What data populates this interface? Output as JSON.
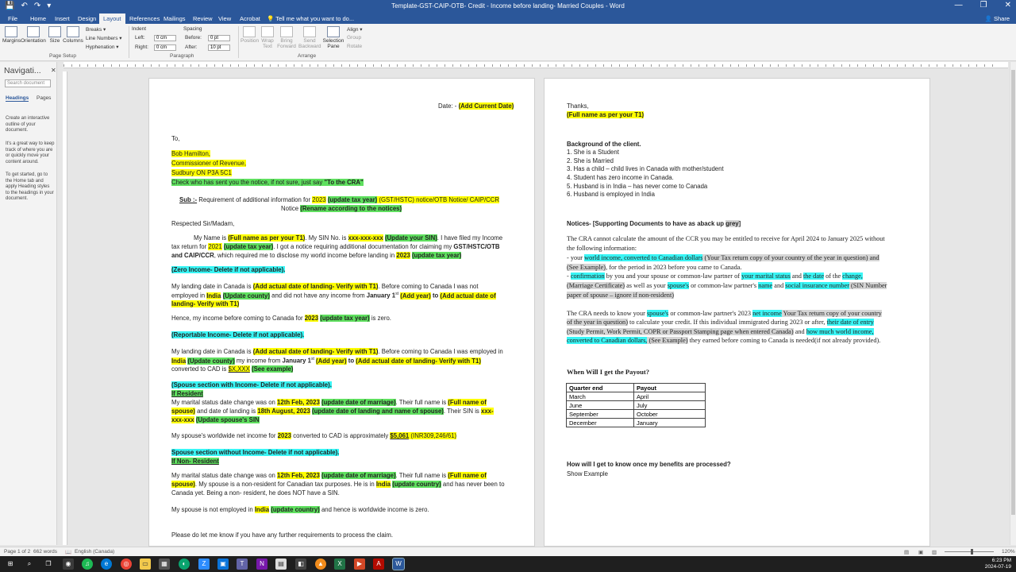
{
  "titlebar": {
    "title": "Template-GST-CAIP-OTB- Credit - Income before landing- Married Couples - Word",
    "qat": [
      "💾",
      "↶",
      "↷",
      "▾"
    ],
    "controls": [
      "—",
      "❐",
      "✕"
    ]
  },
  "tabs": [
    "File",
    "Home",
    "Insert",
    "Design",
    "Layout",
    "References",
    "Mailings",
    "Review",
    "View",
    "Acrobat"
  ],
  "tell_me": "Tell me what you want to do...",
  "share": "Share",
  "ribbon": {
    "margins": "Margins",
    "orientation": "Orientation",
    "size": "Size",
    "columns": "Columns",
    "breaks": "Breaks ▾",
    "line_numbers": "Line Numbers ▾",
    "hyphenation": "Hyphenation ▾",
    "page_setup": "Page Setup",
    "indent": "Indent",
    "left": "Left:",
    "left_val": "0 cm",
    "right": "Right:",
    "right_val": "0 cm",
    "spacing": "Spacing",
    "before": "Before:",
    "before_val": "0 pt",
    "after": "After:",
    "after_val": "10 pt",
    "paragraph": "Paragraph",
    "position": "Position",
    "wrap_text": "Wrap Text",
    "bring_forward": "Bring Forward",
    "send_backward": "Send Backward",
    "selection_pane": "Selection Pane",
    "align": "Align ▾",
    "group": "Group",
    "rotate": "Rotate",
    "arrange": "Arrange"
  },
  "nav": {
    "title": "Navigati...",
    "search_placeholder": "Search document",
    "tab_headings": "Headings",
    "tab_pages": "Pages",
    "text1": "Create an interactive outline of your document.",
    "text2": "It's a great way to keep track of where you are or quickly move your content around.",
    "text3": "To get started, go to the Home tab and apply Heading styles to the headings in your document."
  },
  "page1": {
    "date_label": "Date: - ",
    "date_value": "(Add Current Date)",
    "to": "To,",
    "addr1": "Bob Hamilton,",
    "addr2": "Commissioner of Revenue,",
    "addr3": "Sudbury ON  P3A 5C1",
    "check": "Check who has sent you the notice, if not sure, just say ",
    "check_b": "\"To the CRA\"",
    "sub_label": "Sub :-",
    "sub_text": " Requirement of additional information for ",
    "sub_year": "2023",
    "sub_update": "(update tax year)",
    "sub_rest": " (GST/HSTC) notice/OTB Notice/ CAIP/CCR",
    "notice": "Notice ",
    "notice_rename": "(Rename according to the notices)",
    "respected": "Respected Sir/Madam,",
    "p1a": "My Name is ",
    "p1_name": "(Full name as per your T1)",
    "p1b": ". My SIN No. is ",
    "p1_sin": "xxx-xxx-xxx",
    "p1_sin_u": "(Update your SIN)",
    "p1c": ". I have filed my Income",
    "p1d": "tax return for ",
    "p1_year": "2021",
    "p1_year_u": "(update tax year)",
    "p1e": ". I got a notice requiring additional documentation for claiming my ",
    "p1_gst": "GST/HSTC/OTB",
    "p1f_b": "and CAIP/CCR",
    "p1f": ", which required me to disclose my world income before landing in ",
    "p1_year2": "2023",
    "p1_year2_u": "(update tax year)",
    "zero": "(Zero Income- Delete if not applicable).",
    "p2a": "My landing date in Canada is ",
    "p2_land": "(Add actual date of landing- Verify with T1)",
    "p2b": ". Before coming to Canada I was not",
    "p2c": "employed in ",
    "p2_india": "India",
    "p2_county": "(Update county)",
    "p2d": " and did not have any income from ",
    "p2_jan": "January 1",
    "p2_st": "st",
    "p2_addyear": "(Add year)",
    "p2_to": " to ",
    "p2_actual": "(Add actual date of",
    "p2_land2": "landing- Verify with T1)",
    "hence": "Hence, my income before coming to Canada for ",
    "hence_year": "2023",
    "hence_update": "(update tax year)",
    "hence_end": " is zero.",
    "reportable": "(Reportable Income- Delete if not applicable).",
    "p3a": "My landing date in Canada is ",
    "p3_land": "(Add actual date of landing- Verify with T1)",
    "p3b": ". Before coming to Canada I was employed in",
    "p3_india": "India",
    "p3_county": "(Update county)",
    "p3c": " my income from ",
    "p3_jan": "January 1",
    "p3_st": "st",
    "p3_addyear": "(Add year)",
    "p3_to": " to ",
    "p3_actual": "(Add actual date of landing- Verify with T1)",
    "p3d": "converted to CAD is ",
    "p3_amt": "$X,XXX",
    "p3_example": "(See example)",
    "spouse_with": "(Spouse section with Income- Delete if not applicable).",
    "if_resident": "If Resident",
    "m1a": "My marital status date change was on ",
    "m1_date": "12th Feb, 2023",
    "m1_update": "(update date of marriage)",
    "m1b": ". Their full name is ",
    "m1_name": "(Full name of",
    "m1_spouse": "spouse)",
    "m1c": " and date of landing is ",
    "m1_land": "18th August, 2023",
    "m1_land_u": "(update date of landing and name of spouse)",
    "m1d": ". Their SIN is ",
    "m1_sin": "xxx-",
    "m1_sin2": "xxx-xxx",
    "m1_sin_u": "(Update spouse's SIN",
    "w1a": "My spouse's worldwide net income for ",
    "w1_year": "2023",
    "w1b": " converted to CAD is approximately ",
    "w1_amt": "$5,061",
    "w1_inr": " (INR309,246/61)",
    "spouse_without": "Spouse section without Income- Delete if not applicable).",
    "if_nonres": "If Non- Resident",
    "n1a": "My marital status date change was on ",
    "n1_date": "12th Feb, 2023",
    "n1_update": "(update date of marriage)",
    "n1b": ". Their full name is ",
    "n1_name": "(Full name of",
    "n1_spouse": "spouse)",
    "n1c": ". My spouse is a non-resident for Canadian tax purposes. He is in ",
    "n1_india": "India",
    "n1_country": "(update country)",
    "n1d": " and has never been to",
    "n1e": "Canada yet. Being a non- resident, he does NOT have a SIN.",
    "e1a": "My spouse is not employed in ",
    "e1_india": "India",
    "e1_country": "(update country)",
    "e1b": " and hence is worldwide income is zero.",
    "closing": "Please do let me know if you have any further requirements to process the claim."
  },
  "page2": {
    "thanks": "Thanks,",
    "fullname": "(Full name as per your T1)",
    "bg_title": "Background of the client.",
    "bg": [
      "1. She is a Student",
      "2. She is Married",
      "3. Has a child – child lives in Canada with mother/student",
      "4. Student has zero income in Canada.",
      "5. Husband is in India – has never come to Canada",
      "6. Husband is employed in India"
    ],
    "notices_a": "Notices- [Supporting Documents to have as aback up ",
    "notices_grey": "grey",
    "notices_b": "]",
    "cra1": "The CRA cannot calculate the amount of the CCR you may be entitled to receive for April 2024 to January 2025 without",
    "cra2": "the following information:",
    "cra3a": "- your ",
    "cra3_world": "world income, converted to Canadian dollars",
    "cra3_copy": " (Your Tax return copy of your country of the year in question) and",
    "cra4_ex": "(See Example)",
    "cra4": ", for the period in 2023 before you came to Canada.",
    "cra5a": "- ",
    "cra5_conf": "confirmation",
    "cra5b": " by you and your spouse or common-law partner of ",
    "cra5_ms": "your marital status",
    "cra5c": " and ",
    "cra5_date": "the date",
    "cra5d": " of the ",
    "cra5_change": "change,",
    "cra6_mc": "(Marriage Certificate)",
    "cra6b": " as well as your ",
    "cra6_sp": "spouse's",
    "cra6c": " or common-law partner's ",
    "cra6_name": "name",
    "cra6d": " and ",
    "cra6_sin": "social insurance number",
    "cra6_sinnum": " (SIN Number",
    "cra7": "paper of spouse – ignore if non-resident)",
    "k1a": "The CRA needs to know your ",
    "k1_sp": "spouse's",
    "k1b": " or common-law partner's 2023 ",
    "k1_net": "net income",
    "k1_copy": " Your Tax return copy of your country",
    "k2_year": "of the year in question)",
    "k2b": " to calculate your credit. If this individual immigrated during 2023 or after, ",
    "k2_entry": "their date of entry",
    "k3_permit": "(Study Permit, Work Permit, COPR or Passport Stamping page when entered Canada)",
    "k3b": " and ",
    "k3_how": "how much world income,",
    "k4_conv": "converted to Canadian dollars,",
    "k4_ex": " (See Example)",
    "k4b": " they earned before coming to Canada is needed(if not already provided).",
    "payout_title": "When Will I get the Payout?",
    "payout_headers": [
      "Quarter end",
      "Payout"
    ],
    "payout_rows": [
      [
        "March",
        "April"
      ],
      [
        "June",
        "July"
      ],
      [
        "September",
        "October"
      ],
      [
        "December",
        "January"
      ]
    ],
    "how_title": "How will I get to know once my benefits are processed?",
    "show_example": "Show Example"
  },
  "status": {
    "page": "Page 1 of 2",
    "words": "662 words",
    "lang": "English (Canada)",
    "zoom": "120%"
  },
  "taskbar": {
    "time": "6:23 PM",
    "date": "2024-07-19"
  }
}
